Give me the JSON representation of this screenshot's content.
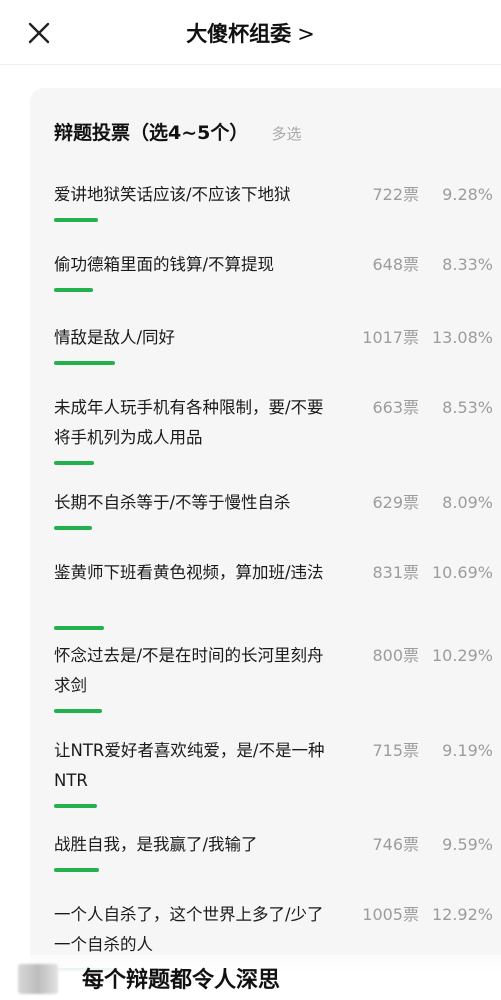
{
  "header": {
    "title": "大傻杯组委",
    "chevron": ">"
  },
  "poll": {
    "title": "辩题投票（选4~5个）",
    "mode": "多选",
    "accent_color": "#22b14c",
    "options": [
      {
        "text": "爱讲地狱笑话应该/不应该下地狱",
        "votes": "722票",
        "percent": "9.28%",
        "fraction": 0.0928
      },
      {
        "text": "偷功德箱里面的钱算/不算提现",
        "votes": "648票",
        "percent": "8.33%",
        "fraction": 0.0833
      },
      {
        "text": "情敌是敌人/同好",
        "votes": "1017票",
        "percent": "13.08%",
        "fraction": 0.1308
      },
      {
        "text": "未成年人玩手机有各种限制，要/不要将手机列为成人用品",
        "votes": "663票",
        "percent": "8.53%",
        "fraction": 0.0853
      },
      {
        "text": "长期不自杀等于/不等于慢性自杀",
        "votes": "629票",
        "percent": "8.09%",
        "fraction": 0.0809
      },
      {
        "text": "鉴黄师下班看黄色视频，算加班/违法",
        "votes": "831票",
        "percent": "10.69%",
        "fraction": 0.1069
      },
      {
        "text": "怀念过去是/不是在时间的长河里刻舟求剑",
        "votes": "800票",
        "percent": "10.29%",
        "fraction": 0.1029
      },
      {
        "text": "让NTR爱好者喜欢纯爱，是/不是一种NTR",
        "votes": "715票",
        "percent": "9.19%",
        "fraction": 0.0919
      },
      {
        "text": "战胜自我，是我赢了/我输了",
        "votes": "746票",
        "percent": "9.59%",
        "fraction": 0.0959
      },
      {
        "text": "一个人自杀了，这个世界上多了/少了一个自杀的人",
        "votes": "1005票",
        "percent": "12.92%",
        "fraction": 0.1292
      }
    ]
  },
  "caption": "每个辩题都令人深思"
}
